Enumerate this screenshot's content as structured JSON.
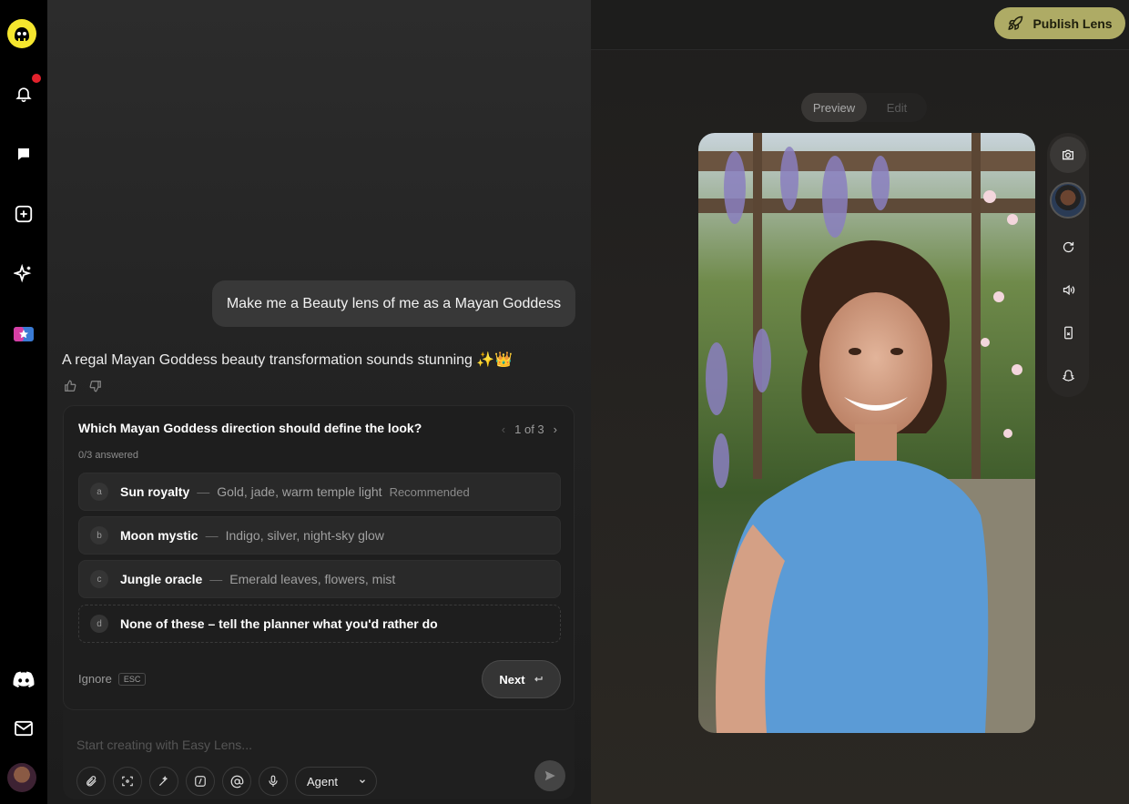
{
  "chat": {
    "user_message": "Make me a Beauty lens of me as a Mayan Goddess",
    "assistant_message": "A regal Mayan Goddess beauty transformation sounds stunning ✨👑",
    "question": {
      "title": "Which Mayan Goddess direction should define the look?",
      "pager": "1 of 3",
      "answered": "0/3 answered",
      "options": [
        {
          "key": "a",
          "title": "Sun royalty",
          "desc": "Gold, jade, warm temple light",
          "tag": "Recommended"
        },
        {
          "key": "b",
          "title": "Moon mystic",
          "desc": "Indigo, silver, night-sky glow",
          "tag": ""
        },
        {
          "key": "c",
          "title": "Jungle oracle",
          "desc": "Emerald leaves, flowers, mist",
          "tag": ""
        },
        {
          "key": "d",
          "title": "None of these – tell the planner what you'd rather do",
          "desc": "",
          "tag": ""
        }
      ],
      "ignore_label": "Ignore",
      "esc_label": "ESC",
      "next_label": "Next"
    },
    "composer": {
      "placeholder": "Start creating with Easy Lens...",
      "agent_label": "Agent"
    }
  },
  "preview": {
    "publish_label": "Publish Lens",
    "tabs": [
      "Preview",
      "Edit"
    ]
  },
  "colors": {
    "accent": "#aeab65",
    "notification": "#e3222c",
    "logo": "#f5e62e"
  }
}
